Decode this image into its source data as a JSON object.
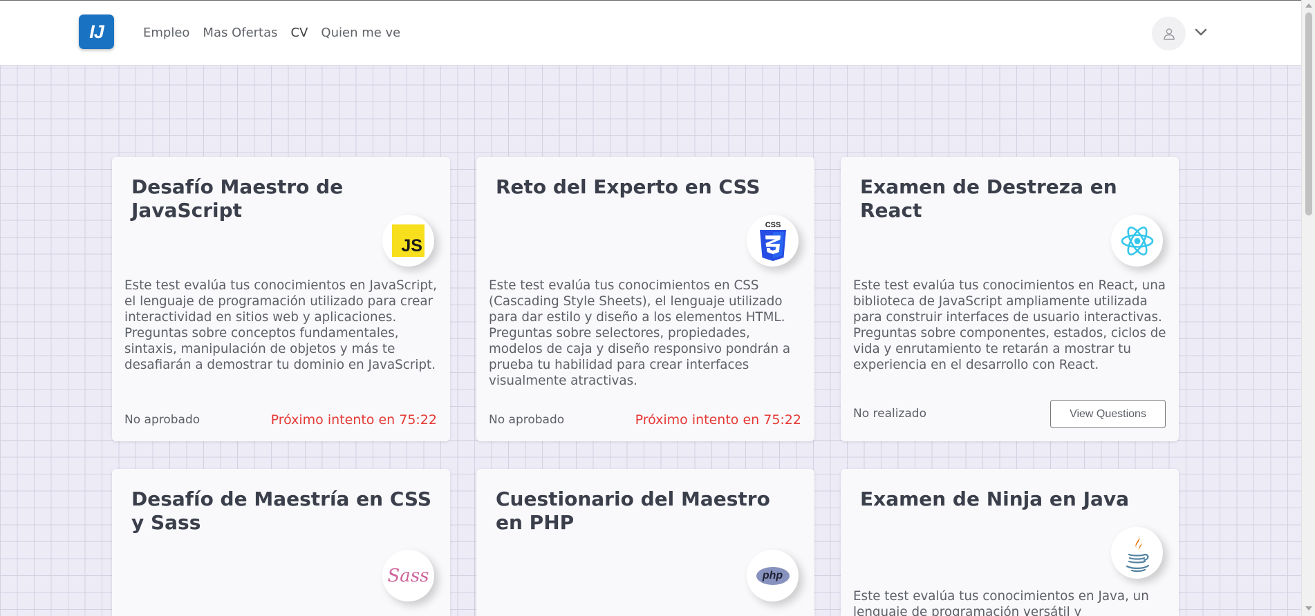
{
  "nav": {
    "logo_text": "IJ",
    "links": [
      "Empleo",
      "Mas Ofertas",
      "CV",
      "Quien me ve"
    ]
  },
  "cards": [
    {
      "title": "Desafío Maestro de JavaScript",
      "icon": "javascript-icon",
      "icon_text": "JS",
      "description": "Este test evalúa tus conocimientos en JavaScript, el lenguaje de programación utilizado para crear interactividad en sitios web y aplicaciones. Preguntas sobre conceptos fundamentales, sintaxis, manipulación de objetos y más te desafiarán a demostrar tu dominio en JavaScript.",
      "status": "No aprobado",
      "retry": "Próximo intento en 75:22"
    },
    {
      "title": "Reto del Experto en CSS",
      "icon": "css3-icon",
      "icon_text": "CSS",
      "description": "Este test evalúa tus conocimientos en CSS (Cascading Style Sheets), el lenguaje utilizado para dar estilo y diseño a los elementos HTML. Preguntas sobre selectores, propiedades, modelos de caja y diseño responsivo pondrán a prueba tu habilidad para crear interfaces visualmente atractivas.",
      "status": "No aprobado",
      "retry": "Próximo intento en 75:22"
    },
    {
      "title": "Examen de Destreza en React",
      "icon": "react-icon",
      "description": "Este test evalúa tus conocimientos en React, una biblioteca de JavaScript ampliamente utilizada para construir interfaces de usuario interactivas. Preguntas sobre componentes, estados, ciclos de vida y enrutamiento te retarán a mostrar tu experiencia en el desarrollo con React.",
      "status": "No realizado",
      "button": "View Questions"
    },
    {
      "title": "Desafío de Maestría en CSS y Sass",
      "icon": "sass-icon",
      "icon_text": "Sass"
    },
    {
      "title": "Cuestionario del Maestro en PHP",
      "icon": "php-icon",
      "icon_text": "php"
    },
    {
      "title": "Examen de Ninja en Java",
      "icon": "java-icon",
      "description": "Este test evalúa tus conocimientos en Java, un lenguaje de programación versátil y ampliamente"
    }
  ],
  "colors": {
    "logo": "#1a73c2",
    "retry": "#e53935",
    "background": "#ecebf6"
  }
}
